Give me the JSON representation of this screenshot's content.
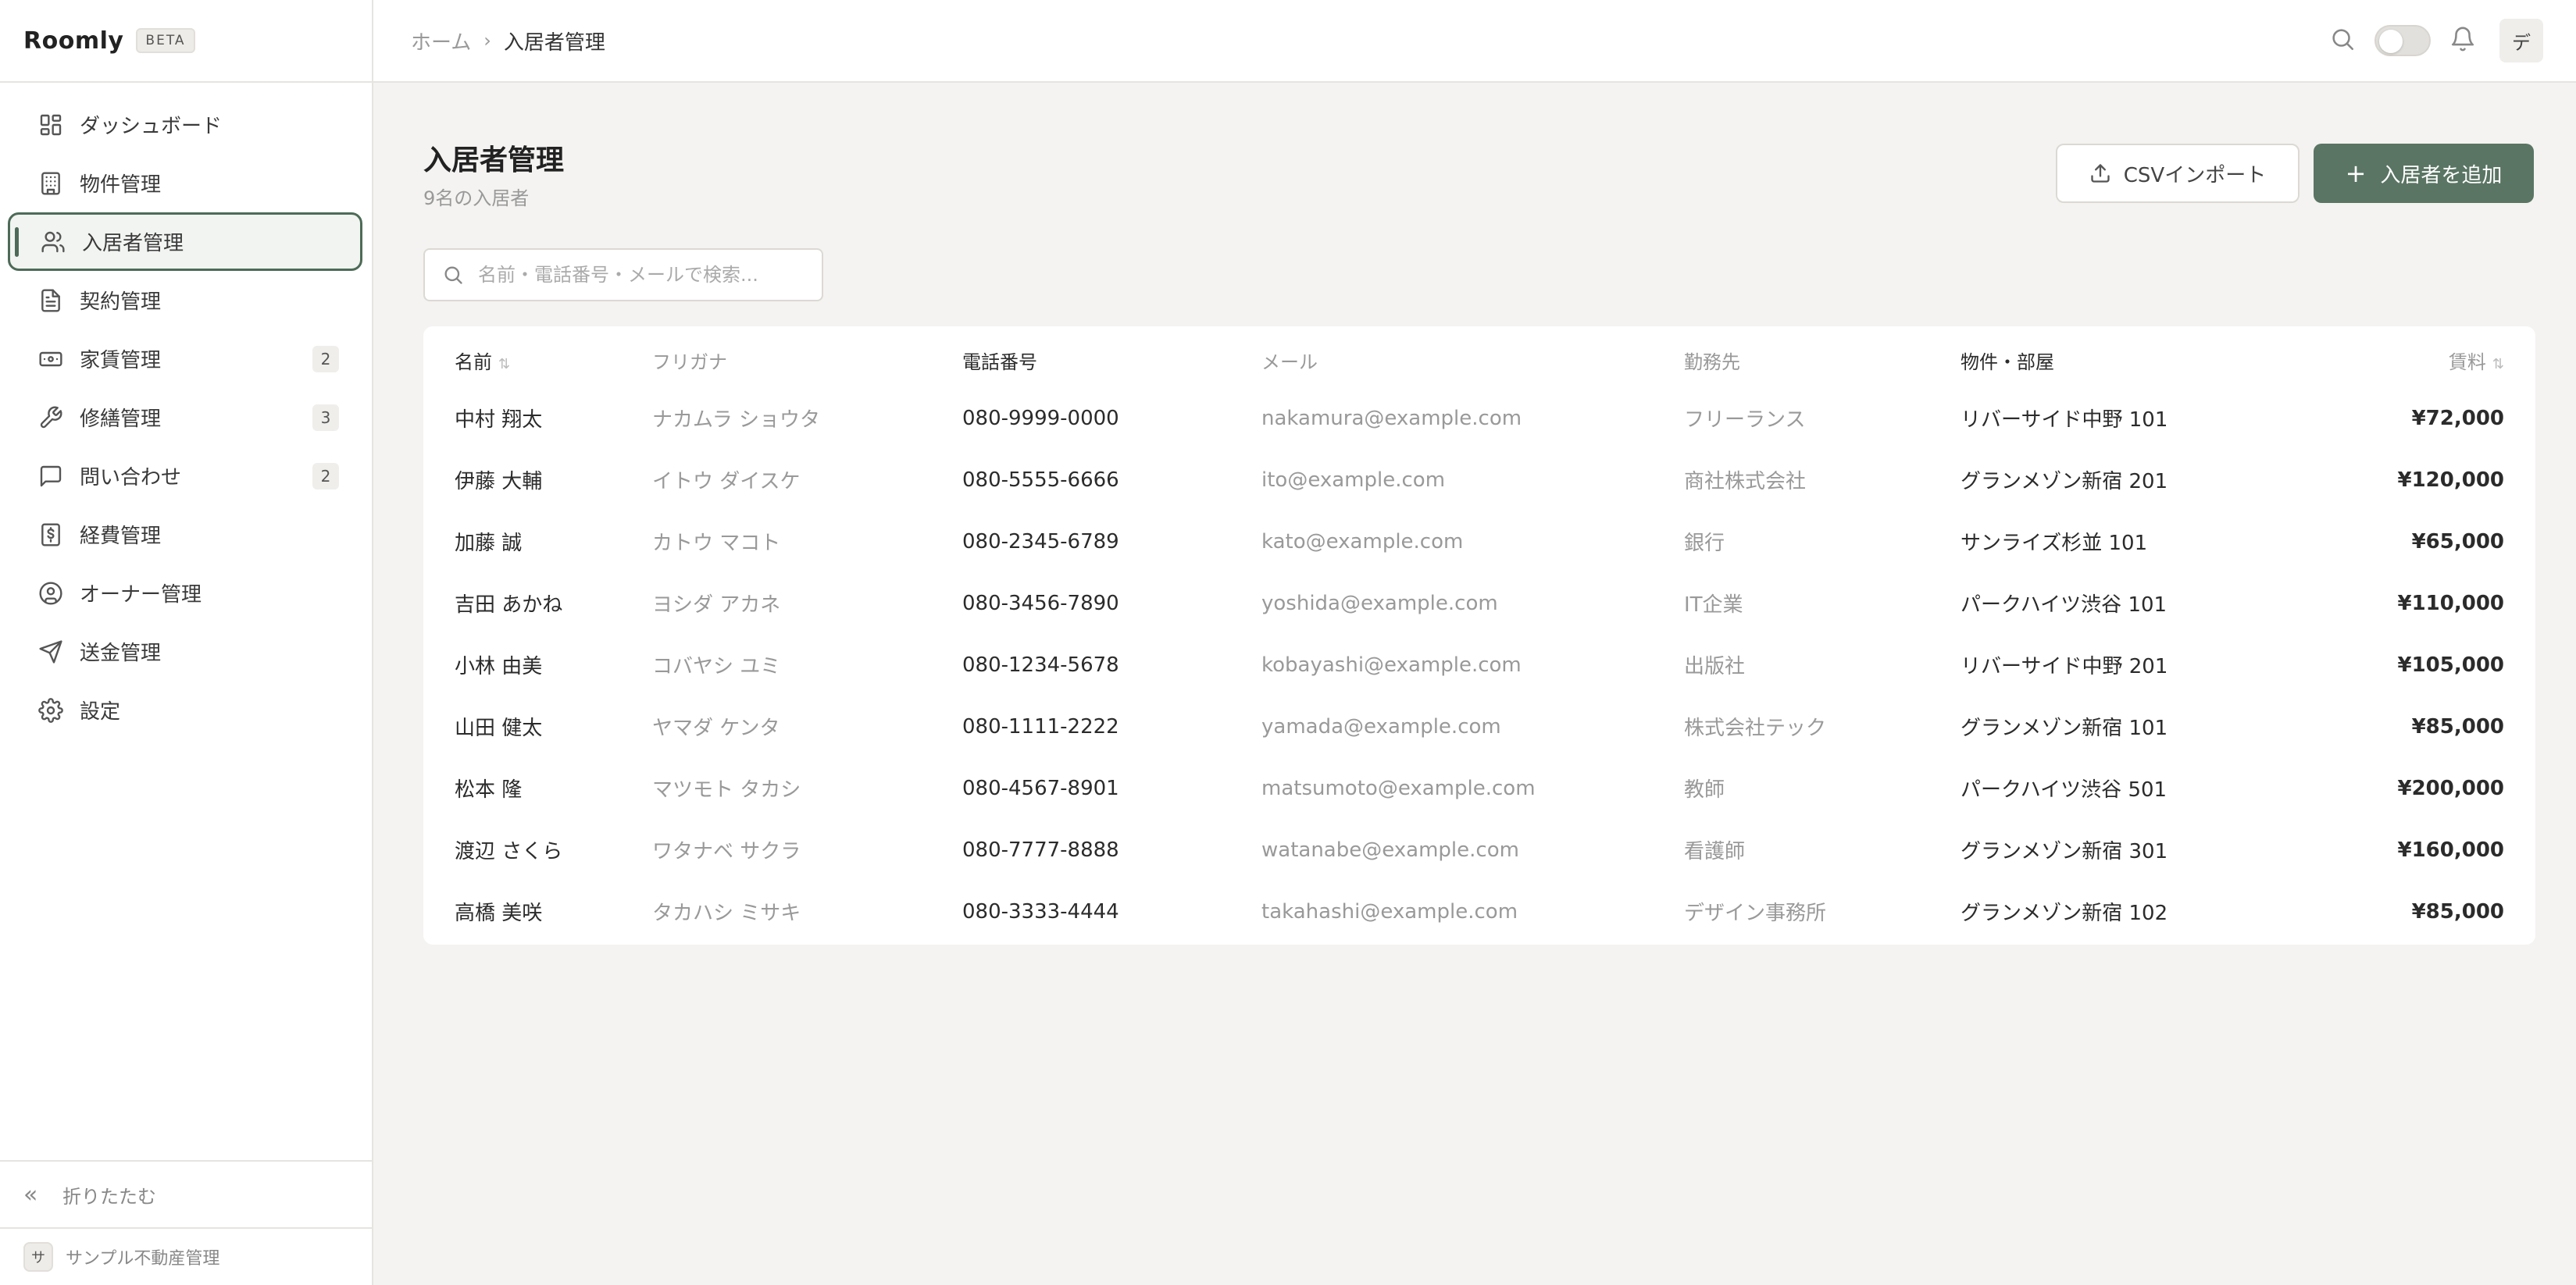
{
  "brand": {
    "name": "Roomly",
    "badge": "BETA"
  },
  "sidebar": {
    "items": [
      {
        "label": "ダッシュボード",
        "icon": "dashboard-icon"
      },
      {
        "label": "物件管理",
        "icon": "building-icon"
      },
      {
        "label": "入居者管理",
        "icon": "users-icon",
        "active": true
      },
      {
        "label": "契約管理",
        "icon": "document-icon"
      },
      {
        "label": "家賃管理",
        "icon": "banknote-icon",
        "badge": "2"
      },
      {
        "label": "修繕管理",
        "icon": "wrench-icon",
        "badge": "3"
      },
      {
        "label": "問い合わせ",
        "icon": "message-icon",
        "badge": "2"
      },
      {
        "label": "経費管理",
        "icon": "receipt-icon"
      },
      {
        "label": "オーナー管理",
        "icon": "user-circle-icon"
      },
      {
        "label": "送金管理",
        "icon": "send-icon"
      },
      {
        "label": "設定",
        "icon": "gear-icon"
      }
    ],
    "collapse_label": "折りたたむ",
    "org": {
      "avatar": "サ",
      "name": "サンプル不動産管理"
    }
  },
  "header": {
    "breadcrumb": {
      "home": "ホーム",
      "current": "入居者管理"
    },
    "user_initial": "デ"
  },
  "main": {
    "title": "入居者管理",
    "subtitle": "9名の入居者",
    "csv_button": "CSVインポート",
    "add_button": "入居者を追加",
    "search_placeholder": "名前・電話番号・メールで検索..."
  },
  "table": {
    "columns": [
      "名前",
      "フリガナ",
      "電話番号",
      "メール",
      "勤務先",
      "物件・部屋",
      "賃料"
    ],
    "rows": [
      [
        "中村 翔太",
        "ナカムラ ショウタ",
        "080-9999-0000",
        "nakamura@example.com",
        "フリーランス",
        "リバーサイド中野 101",
        "¥72,000"
      ],
      [
        "伊藤 大輔",
        "イトウ ダイスケ",
        "080-5555-6666",
        "ito@example.com",
        "商社株式会社",
        "グランメゾン新宿 201",
        "¥120,000"
      ],
      [
        "加藤 誠",
        "カトウ マコト",
        "080-2345-6789",
        "kato@example.com",
        "銀行",
        "サンライズ杉並 101",
        "¥65,000"
      ],
      [
        "吉田 あかね",
        "ヨシダ アカネ",
        "080-3456-7890",
        "yoshida@example.com",
        "IT企業",
        "パークハイツ渋谷 101",
        "¥110,000"
      ],
      [
        "小林 由美",
        "コバヤシ ユミ",
        "080-1234-5678",
        "kobayashi@example.com",
        "出版社",
        "リバーサイド中野 201",
        "¥105,000"
      ],
      [
        "山田 健太",
        "ヤマダ ケンタ",
        "080-1111-2222",
        "yamada@example.com",
        "株式会社テック",
        "グランメゾン新宿 101",
        "¥85,000"
      ],
      [
        "松本 隆",
        "マツモト タカシ",
        "080-4567-8901",
        "matsumoto@example.com",
        "教師",
        "パークハイツ渋谷 501",
        "¥200,000"
      ],
      [
        "渡辺 さくら",
        "ワタナベ サクラ",
        "080-7777-8888",
        "watanabe@example.com",
        "看護師",
        "グランメゾン新宿 301",
        "¥160,000"
      ],
      [
        "高橋 美咲",
        "タカハシ ミサキ",
        "080-3333-4444",
        "takahashi@example.com",
        "デザイン事務所",
        "グランメゾン新宿 102",
        "¥85,000"
      ]
    ]
  },
  "colors": {
    "accent": "#5a7563",
    "active_border": "#4d6b57",
    "background": "#f4f3f1"
  }
}
